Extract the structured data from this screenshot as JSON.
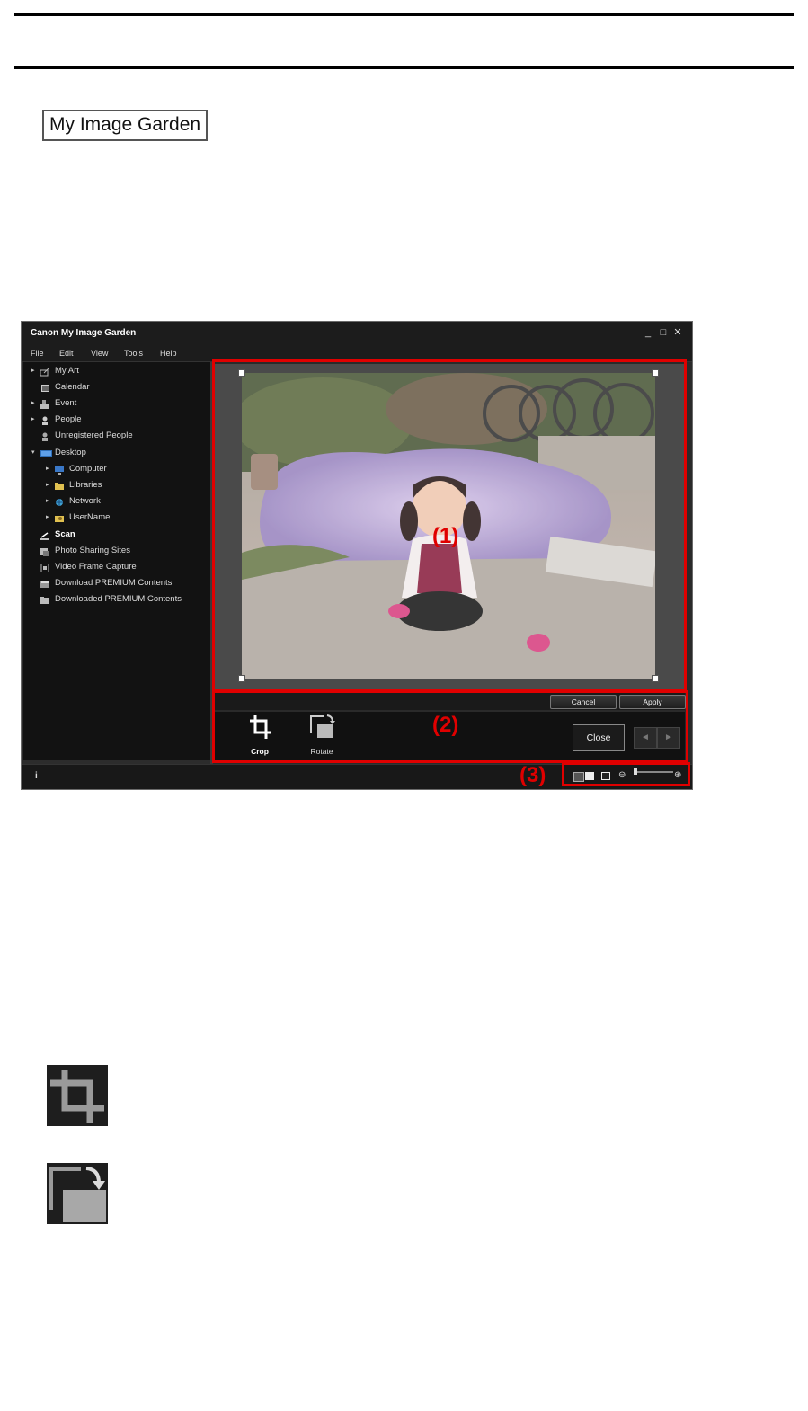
{
  "page": {
    "app_name_badge": "My Image Garden"
  },
  "window": {
    "title": "Canon My Image Garden",
    "controls": {
      "minimize": "_",
      "maximize": "□",
      "close": "✕"
    },
    "menu": [
      "File",
      "Edit",
      "View",
      "Tools",
      "Help"
    ]
  },
  "sidebar": {
    "items": [
      {
        "label": "My Art",
        "arrow": "▸",
        "icon": "my-art-icon",
        "bold": false
      },
      {
        "label": "Calendar",
        "arrow": "",
        "icon": "calendar-icon",
        "bold": false
      },
      {
        "label": "Event",
        "arrow": "▸",
        "icon": "event-icon",
        "bold": false
      },
      {
        "label": "People",
        "arrow": "▸",
        "icon": "people-icon",
        "bold": false
      },
      {
        "label": "Unregistered People",
        "arrow": "",
        "icon": "person-icon",
        "bold": false
      },
      {
        "label": "Desktop",
        "arrow": "▾",
        "icon": "desktop-icon",
        "bold": false
      },
      {
        "label": "Computer",
        "arrow": "▸",
        "icon": "computer-icon",
        "bold": false
      },
      {
        "label": "Libraries",
        "arrow": "▸",
        "icon": "folder-icon",
        "bold": false
      },
      {
        "label": "Network",
        "arrow": "▸",
        "icon": "network-icon",
        "bold": false
      },
      {
        "label": "UserName",
        "arrow": "▸",
        "icon": "user-folder-icon",
        "bold": false
      },
      {
        "label": "Scan",
        "arrow": "",
        "icon": "scan-icon",
        "bold": true
      },
      {
        "label": "Photo Sharing Sites",
        "arrow": "",
        "icon": "photo-sharing-icon",
        "bold": false
      },
      {
        "label": "Video Frame Capture",
        "arrow": "",
        "icon": "video-frame-icon",
        "bold": false
      },
      {
        "label": "Download PREMIUM Contents",
        "arrow": "",
        "icon": "download-icon",
        "bold": false
      },
      {
        "label": "Downloaded PREMIUM Contents",
        "arrow": "",
        "icon": "folder-icon",
        "bold": false
      }
    ]
  },
  "edit": {
    "cancel_label": "Cancel",
    "apply_label": "Apply",
    "tools": [
      {
        "label": "Crop",
        "icon": "crop-icon",
        "active": true
      },
      {
        "label": "Rotate",
        "icon": "rotate-icon",
        "active": false
      }
    ],
    "close_label": "Close",
    "prev": "◄",
    "next": "►"
  },
  "status": {
    "info": "i",
    "zoom_out": "⊖",
    "zoom_in": "⊕",
    "zoom_level": 0.05
  },
  "callouts": [
    "(1)",
    "(2)",
    "(3)"
  ],
  "colors": {
    "callout": "#e00000",
    "window_bg": "#2a2a2a"
  }
}
